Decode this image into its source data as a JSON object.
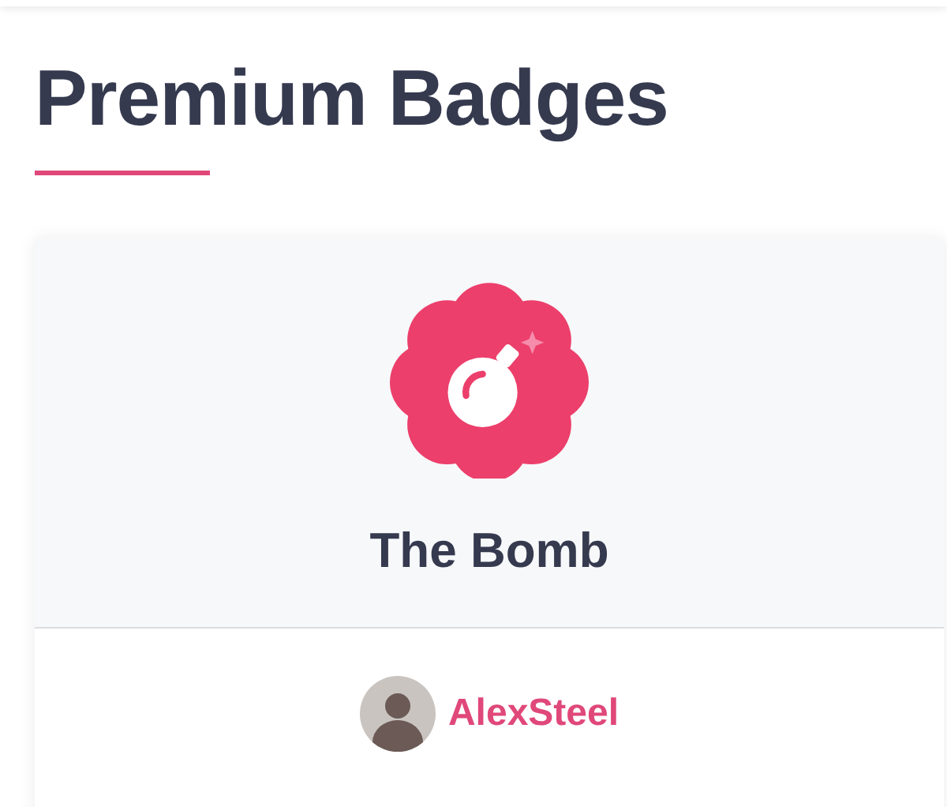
{
  "heading": "Premium Badges",
  "badge": {
    "name": "The Bomb"
  },
  "owner": {
    "username": "AlexSteel"
  }
}
